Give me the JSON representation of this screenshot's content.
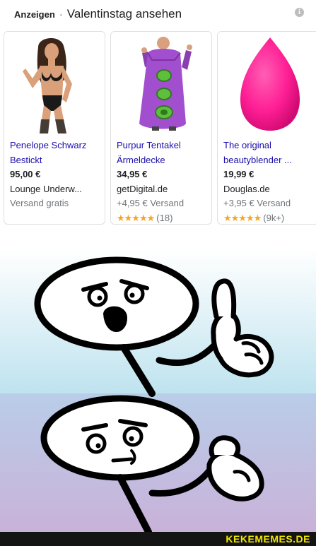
{
  "ads": {
    "prefix": "Anzeigen",
    "separator": "·",
    "title": "Valentinstag ansehen",
    "info_icon": "info-icon"
  },
  "products": [
    {
      "title_line1": "Penelope Schwarz",
      "title_line2": "Bestickt",
      "price": "95,00 €",
      "merchant": "Lounge Underw...",
      "shipping": "Versand gratis",
      "image": "lingerie-model-photo"
    },
    {
      "title_line1": "Purpur Tentakel",
      "title_line2": "Ärmeldecke",
      "price": "34,95 €",
      "merchant": "getDigital.de",
      "shipping": "+4,95 € Versand",
      "stars": "★★★★★",
      "reviews": "(18)",
      "rating": 5,
      "image": "purple-tentacle-blanket-photo"
    },
    {
      "title_line1": "The original",
      "title_line2": "beautyblender ...",
      "price": "19,99 €",
      "merchant": "Douglas.de",
      "shipping": "+3,95 € Versand",
      "stars": "★★★★★",
      "reviews": "(9k+)",
      "rating": 4.5,
      "image": "pink-makeup-sponge-photo"
    }
  ],
  "meme": {
    "panels": [
      "stickman-pointing-shouting",
      "stickman-pointing-doubtful"
    ],
    "colors": {
      "top_panel": "#c5e6f0",
      "bottom_panel": "#c7b3d9"
    }
  },
  "watermark": "KEKEMEMES.DE"
}
